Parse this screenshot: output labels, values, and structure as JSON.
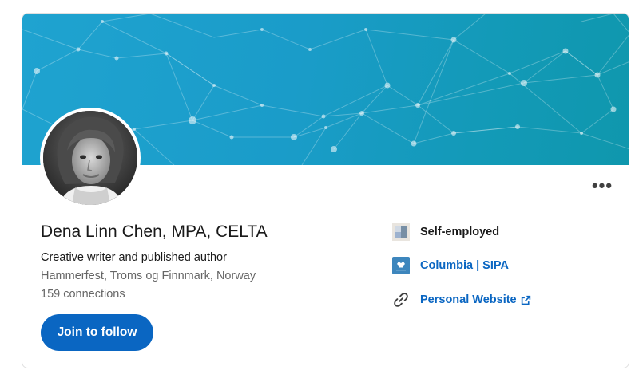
{
  "profile": {
    "name": "Dena Linn Chen, MPA, CELTA",
    "headline": "Creative writer and published author",
    "location": "Hammerfest, Troms og Finnmark, Norway",
    "connections": "159 connections",
    "avatar_icon": "profile-photo"
  },
  "actions": {
    "join_label": "Join to follow",
    "more_label": "•••"
  },
  "sidebar": {
    "items": [
      {
        "label": "Self-employed",
        "icon": "company-logo-icon"
      },
      {
        "label": "Columbia | SIPA",
        "icon": "school-logo-icon"
      },
      {
        "label": "Personal Website",
        "icon": "link-icon",
        "external_icon": "external-link-icon"
      }
    ]
  },
  "colors": {
    "brand_blue": "#0a66c2",
    "banner_start": "#1fa3d0",
    "banner_end": "#0f97ad",
    "text_primary": "#191919",
    "text_secondary": "#666666"
  }
}
